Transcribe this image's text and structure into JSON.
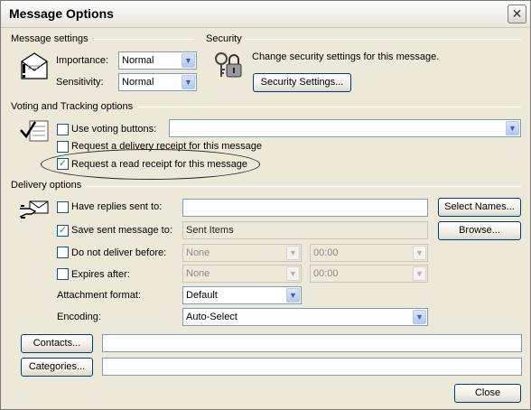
{
  "window": {
    "title": "Message Options",
    "close_glyph": "✕"
  },
  "message_settings": {
    "label": "Message settings",
    "importance_label": "Importance:",
    "importance_value": "Normal",
    "sensitivity_label": "Sensitivity:",
    "sensitivity_value": "Normal",
    "icon": "envelope-importance-icon"
  },
  "security": {
    "label": "Security",
    "description": "Change security settings for this message.",
    "button": "Security Settings...",
    "icon": "keys-lock-icon"
  },
  "voting": {
    "label": "Voting and Tracking options",
    "icon": "checklist-icon",
    "use_voting_label": "Use voting buttons:",
    "use_voting_checked": false,
    "voting_value": "",
    "delivery_receipt_label": "Request a delivery receipt for this message",
    "delivery_receipt_checked": false,
    "read_receipt_label": "Request a read receipt for this message",
    "read_receipt_checked": true
  },
  "delivery": {
    "label": "Delivery options",
    "icon": "hand-envelope-icon",
    "replies_label": "Have replies sent to:",
    "replies_checked": false,
    "replies_value": "",
    "select_names_button": "Select Names...",
    "save_label": "Save sent message to:",
    "save_checked": true,
    "save_value": "Sent Items",
    "browse_button": "Browse...",
    "not_before_label": "Do not deliver before:",
    "not_before_checked": false,
    "not_before_date": "None",
    "not_before_time": "00:00",
    "expires_label": "Expires after:",
    "expires_checked": false,
    "expires_date": "None",
    "expires_time": "00:00",
    "attachment_label": "Attachment format:",
    "attachment_value": "Default",
    "encoding_label": "Encoding:",
    "encoding_value": "Auto-Select"
  },
  "contacts": {
    "button": "Contacts...",
    "value": ""
  },
  "categories": {
    "button": "Categories...",
    "value": ""
  },
  "footer": {
    "close_button": "Close"
  },
  "glyphs": {
    "check": "✓",
    "dropdown": "▼"
  }
}
